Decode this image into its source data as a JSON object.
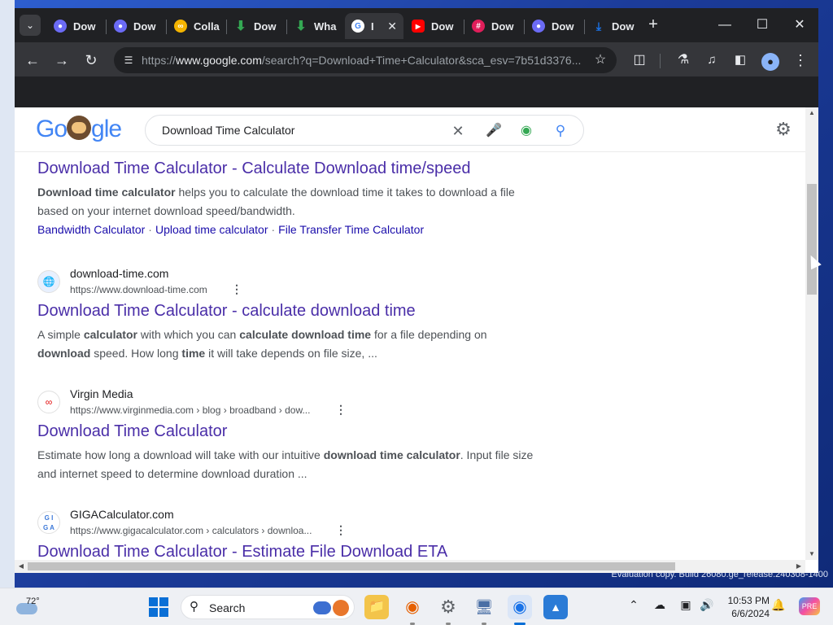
{
  "browser": {
    "tabs": [
      {
        "label": "Dow",
        "favicon": "chatgpt-icon",
        "color": "#6b6bf5"
      },
      {
        "label": "Dow",
        "favicon": "chatgpt-icon",
        "color": "#6b6bf5"
      },
      {
        "label": "Colla",
        "favicon": "colab-icon",
        "color": "#f4b400"
      },
      {
        "label": "Dow",
        "favicon": "download-arrow-icon",
        "color": "#34a853"
      },
      {
        "label": "Wha",
        "favicon": "download-arrow-icon",
        "color": "#34a853"
      },
      {
        "label": "I",
        "favicon": "google-icon",
        "color": "#ffffff",
        "active": true
      },
      {
        "label": "Dow",
        "favicon": "youtube-icon",
        "color": "#ff0000"
      },
      {
        "label": "Dow",
        "favicon": "slack-icon",
        "color": "#e01e5a"
      },
      {
        "label": "Dow",
        "favicon": "chatgpt-icon",
        "color": "#6b6bf5"
      },
      {
        "label": "Dow",
        "favicon": "download-icon",
        "color": "#1a73e8"
      }
    ],
    "new_tab_label": "+",
    "url_prefix": "https://",
    "url_host": "www.google.com",
    "url_rest": "/search?q=Download+Time+Calculator&sca_esv=7b51d3376..."
  },
  "google": {
    "logo_left": "Go",
    "logo_right": "gle",
    "search_query": "Download Time Calculator"
  },
  "results": [
    {
      "title": "Download Time Calculator - Calculate Download time/speed",
      "snippet_parts": [
        {
          "t": "Download time calculator",
          "b": true
        },
        {
          "t": " helps you to calculate the download time it takes to download a file based on your internet download speed/bandwidth.",
          "b": false
        }
      ],
      "sitelinks": [
        "Bandwidth Calculator",
        "Upload time calculator",
        "File Transfer Time Calculator"
      ]
    },
    {
      "site_name": "download-time.com",
      "site_url": "https://www.download-time.com",
      "title": "Download Time Calculator - calculate download time",
      "snippet_parts": [
        {
          "t": "A simple ",
          "b": false
        },
        {
          "t": "calculator",
          "b": true
        },
        {
          "t": " with which you can ",
          "b": false
        },
        {
          "t": "calculate download time",
          "b": true
        },
        {
          "t": " for a file depending on ",
          "b": false
        },
        {
          "t": "download",
          "b": true
        },
        {
          "t": " speed. How long ",
          "b": false
        },
        {
          "t": "time",
          "b": true
        },
        {
          "t": " it will take depends on file size, ...",
          "b": false
        }
      ]
    },
    {
      "site_name": "Virgin Media",
      "site_url": "https://www.virginmedia.com › blog › broadband › dow...",
      "title": "Download Time Calculator",
      "snippet_parts": [
        {
          "t": "Estimate how long a download will take with our intuitive ",
          "b": false
        },
        {
          "t": "download time calculator",
          "b": true
        },
        {
          "t": ". Input file size and internet speed to determine download duration ...",
          "b": false
        }
      ]
    },
    {
      "site_name": "GIGACalculator.com",
      "site_url": "https://www.gigacalculator.com › calculators › downloa...",
      "title": "Download Time Calculator - Estimate File Download ETA"
    }
  ],
  "taskbar": {
    "weather_temp": "72°",
    "search_label": "Search",
    "time": "10:53 PM",
    "date": "6/6/2024"
  },
  "desktop": {
    "watermark": "Evaluation copy. Build 26080.ge_release.240308-1400"
  }
}
